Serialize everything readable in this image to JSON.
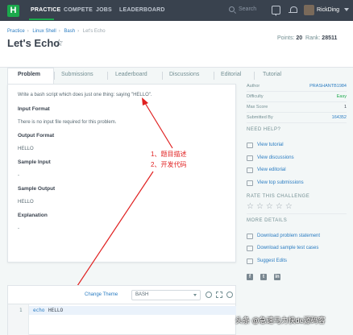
{
  "nav": {
    "logo": "H",
    "links": [
      "PRACTICE",
      "COMPETE",
      "JOBS",
      "LEADERBOARD"
    ],
    "search_placeholder": "Search",
    "username": "RickDing"
  },
  "breadcrumb": [
    "Practice",
    "Linux Shell",
    "Bash",
    "Let's Echo"
  ],
  "page_title": "Let's Echo",
  "stats": {
    "points_label": "Points:",
    "points": "20",
    "rank_label": "Rank:",
    "rank": "28511"
  },
  "tabs": [
    "Problem",
    "Submissions",
    "Leaderboard",
    "Discussions",
    "Editorial",
    "Tutorial"
  ],
  "problem": {
    "statement": "Write a bash script which does just one thing: saying \"HELLO\".",
    "input_format_h": "Input Format",
    "input_format": "There is no input file required for this problem.",
    "output_format_h": "Output Format",
    "output_format": "HELLO",
    "sample_input_h": "Sample Input",
    "sample_input": "-",
    "sample_output_h": "Sample Output",
    "sample_output": "HELLO",
    "explanation_h": "Explanation",
    "explanation": "-"
  },
  "meta": [
    {
      "label": "Author",
      "value": "PRASHANTB1984"
    },
    {
      "label": "Difficulty",
      "value": "Easy"
    },
    {
      "label": "Max Score",
      "value": "1"
    },
    {
      "label": "Submitted By",
      "value": "164352"
    }
  ],
  "need_help": {
    "heading": "NEED HELP?",
    "links": [
      "View tutorial",
      "View discussions",
      "View editorial",
      "View top submissions"
    ]
  },
  "rate": {
    "heading": "RATE THIS CHALLENGE",
    "stars": "☆☆☆☆☆"
  },
  "more_details": {
    "heading": "MORE DETAILS",
    "links": [
      "Download problem statement",
      "Download sample test cases",
      "Suggest Edits"
    ]
  },
  "annotation": {
    "line1": "1、题目描述",
    "line2": "2、开发代码"
  },
  "editor": {
    "change_theme": "Change Theme",
    "language": "BASH",
    "line_number": "1",
    "keyword": "echo",
    "argument": "HELLO"
  },
  "watermark": "头条 @急速马力快de源码客",
  "colors": {
    "nav_bg": "#39424e",
    "brand": "#1ba94c",
    "link": "#2a7cc2",
    "annotation": "#e02020"
  }
}
